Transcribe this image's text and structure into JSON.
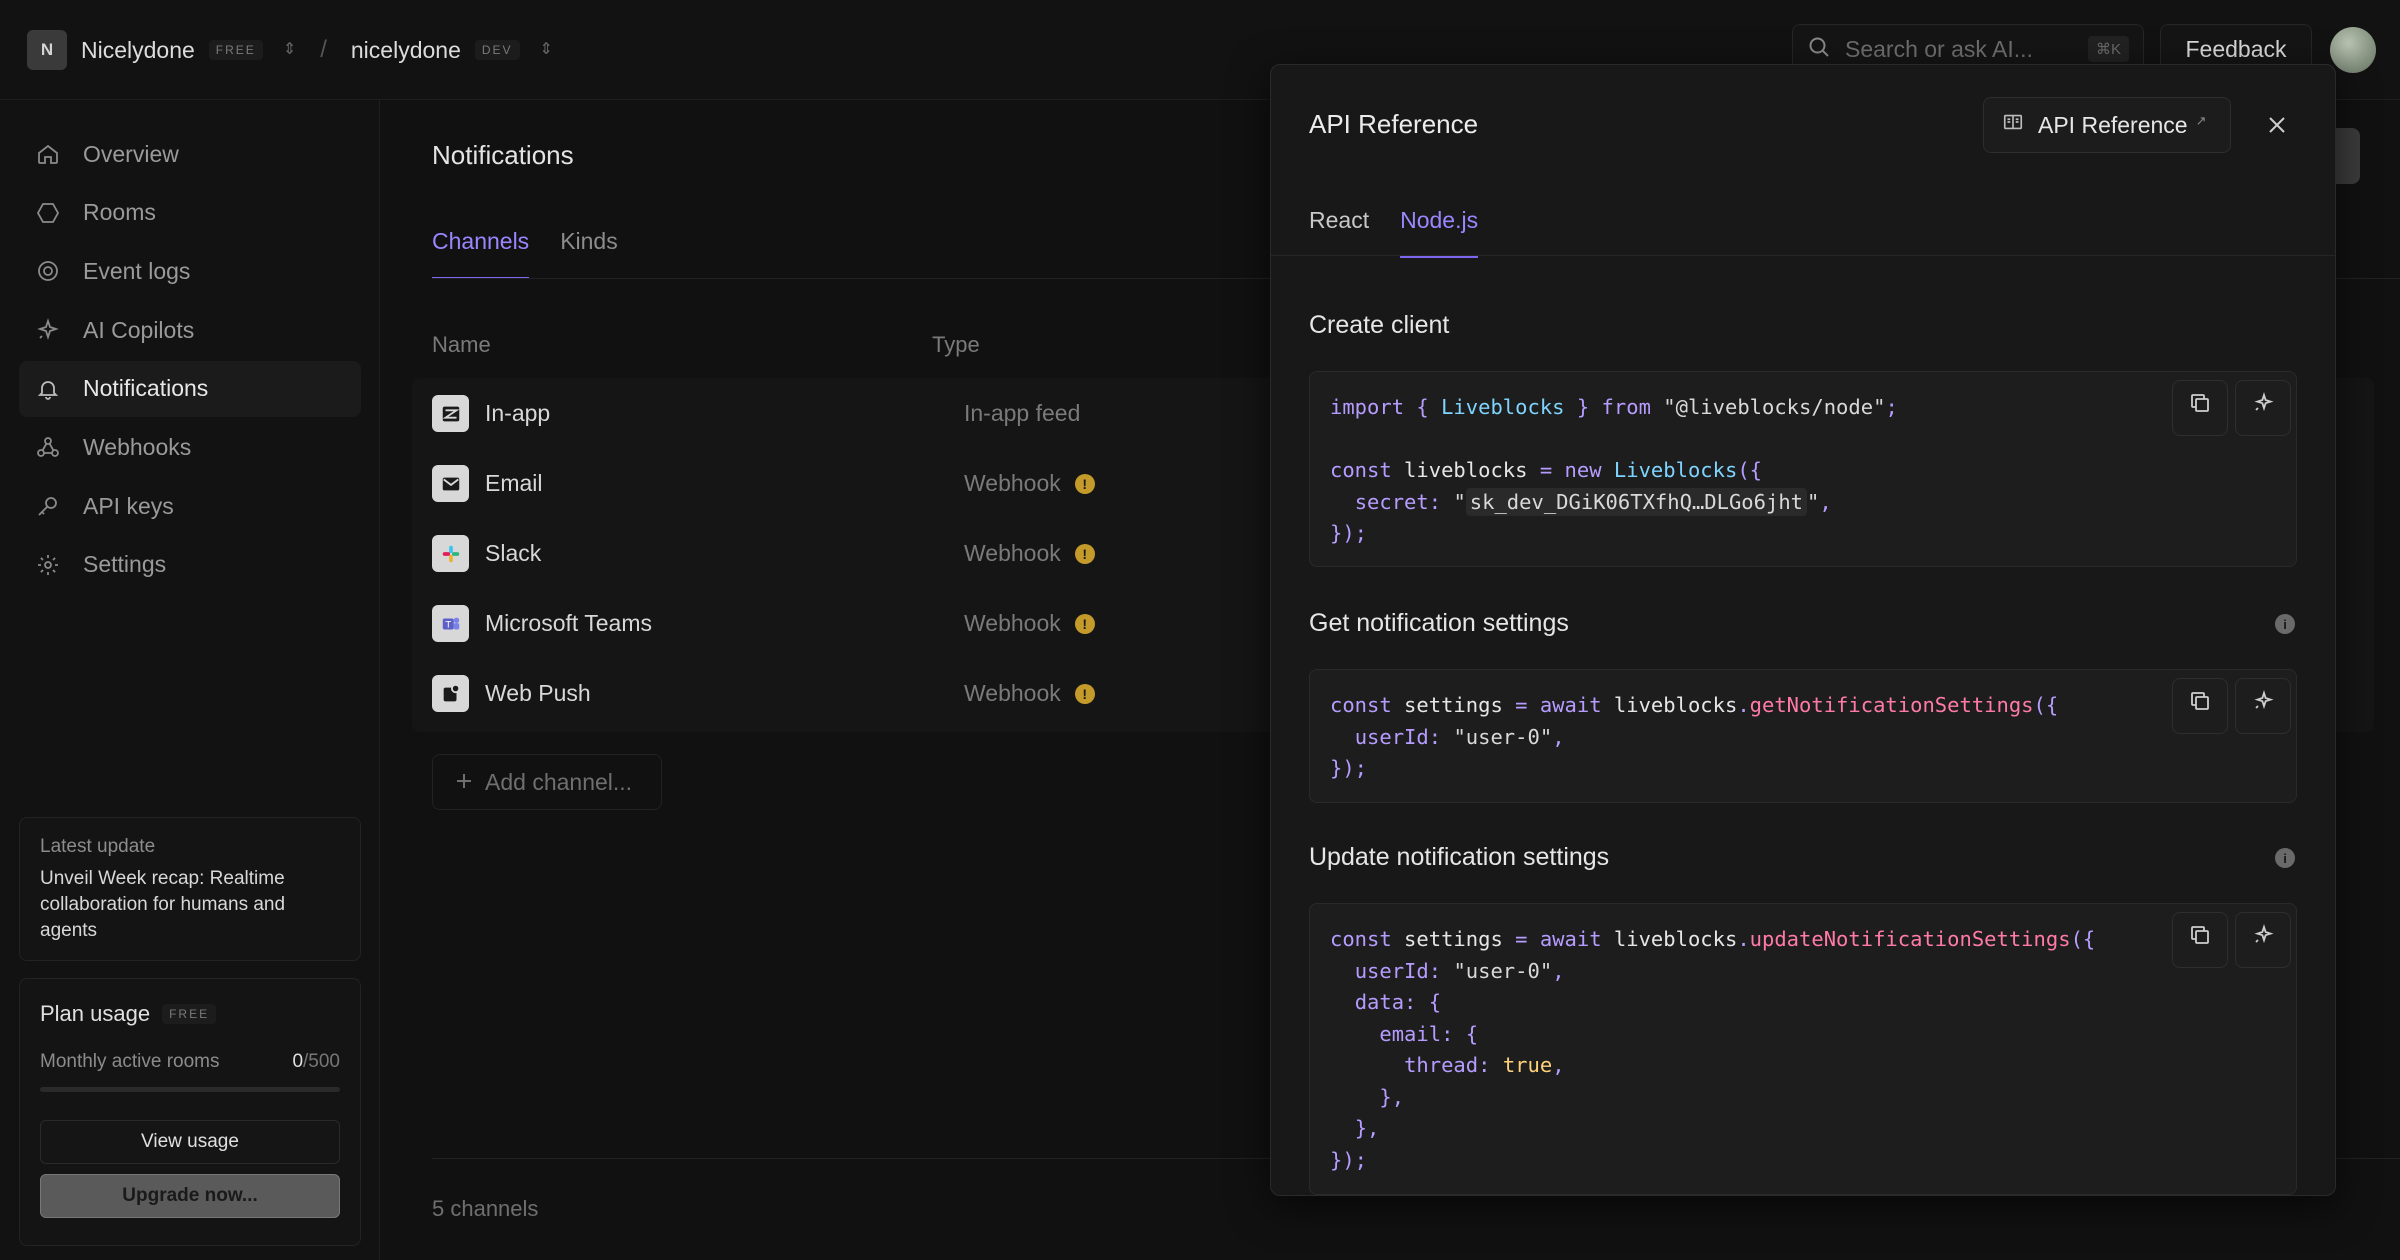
{
  "topbar": {
    "org_initial": "N",
    "org_name": "Nicelydone",
    "org_plan_badge": "FREE",
    "separator": "/",
    "project_name": "nicelydone",
    "project_env_badge": "DEV",
    "search_placeholder": "Search or ask AI...",
    "search_shortcut": "⌘K",
    "feedback_label": "Feedback"
  },
  "sidebar": {
    "items": [
      {
        "label": "Overview",
        "icon": "home-icon"
      },
      {
        "label": "Rooms",
        "icon": "hexagon-icon"
      },
      {
        "label": "Event logs",
        "icon": "target-icon"
      },
      {
        "label": "AI Copilots",
        "icon": "sparkle-icon"
      },
      {
        "label": "Notifications",
        "icon": "bell-icon",
        "active": true
      },
      {
        "label": "Webhooks",
        "icon": "webhook-icon"
      },
      {
        "label": "API keys",
        "icon": "key-icon"
      },
      {
        "label": "Settings",
        "icon": "gear-icon"
      }
    ],
    "latest_update": {
      "kicker": "Latest update",
      "text": "Unveil Week recap: Realtime collaboration for humans and agents"
    },
    "plan": {
      "title": "Plan usage",
      "badge": "FREE",
      "metric_label": "Monthly active rooms",
      "used": "0",
      "limit": "/500",
      "usage_fraction": 0,
      "view_usage_label": "View usage",
      "upgrade_label": "Upgrade now..."
    }
  },
  "main": {
    "title": "Notifications",
    "tabs": [
      {
        "label": "Channels",
        "active": true
      },
      {
        "label": "Kinds",
        "active": false
      }
    ],
    "columns": {
      "name": "Name",
      "type": "Type"
    },
    "rows": [
      {
        "name": "In-app",
        "type": "In-app feed",
        "warning": false,
        "icon": "inapp-icon"
      },
      {
        "name": "Email",
        "type": "Webhook",
        "warning": true,
        "icon": "email-icon"
      },
      {
        "name": "Slack",
        "type": "Webhook",
        "warning": true,
        "icon": "slack-icon"
      },
      {
        "name": "Microsoft Teams",
        "type": "Webhook",
        "warning": true,
        "icon": "teams-icon"
      },
      {
        "name": "Web Push",
        "type": "Webhook",
        "warning": true,
        "icon": "webpush-icon"
      }
    ],
    "warning_glyph": "!",
    "add_channel_label": "Add channel...",
    "count_label": "5 channels"
  },
  "panel": {
    "title": "API Reference",
    "link_label": "API Reference",
    "tabs": [
      {
        "label": "React",
        "active": false
      },
      {
        "label": "Node.js",
        "active": true
      }
    ],
    "info_glyph": "i",
    "sections": [
      {
        "title": "Create client",
        "has_info": false
      },
      {
        "title": "Get notification settings",
        "has_info": true
      },
      {
        "title": "Update notification settings",
        "has_info": true
      }
    ],
    "code": {
      "create_client": {
        "import_stmt": "import { Liveblocks } from \"@liveblocks/node\";",
        "const_line_prefix": "const liveblocks = new Liveblocks({",
        "secret_key": "secret:",
        "secret_value": "sk_dev_DGiK06TXfhQ…DLGo6jht",
        "close": "});"
      },
      "get_settings": {
        "call": "getNotificationSettings",
        "user_id_value": "\"user-0\""
      },
      "update_settings": {
        "call": "updateNotificationSettings",
        "user_id_value": "\"user-0\"",
        "thread_value": "true"
      }
    }
  },
  "colors": {
    "accent": "#9b86ff",
    "background": "#111111",
    "warning": "#c49a2a"
  }
}
